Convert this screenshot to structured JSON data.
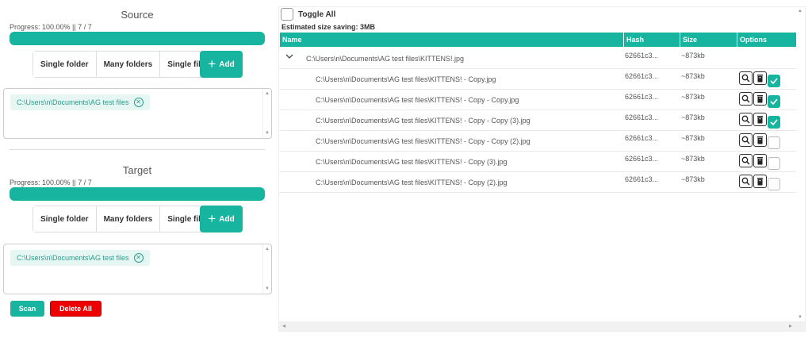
{
  "source": {
    "title": "Source",
    "progress_label": "Progress: 100.00% || 7 / 7",
    "progress": 1.0,
    "modes": [
      "Single folder",
      "Many folders",
      "Single file"
    ],
    "active_mode": 0,
    "add_label": "Add",
    "folders": [
      "C:\\Users\\n\\Documents\\AG test files"
    ]
  },
  "target": {
    "title": "Target",
    "progress_label": "Progress: 100.00% || 7 / 7",
    "progress": 1.0,
    "modes": [
      "Single folder",
      "Many folders",
      "Single file"
    ],
    "active_mode": 0,
    "add_label": "Add",
    "folders": [
      "C:\\Users\\n\\Documents\\AG test files"
    ]
  },
  "actions": {
    "scan_label": "Scan",
    "delete_all_label": "Delete All"
  },
  "results": {
    "toggle_all_label": "Toggle All",
    "estimate_label": "Estimated size saving: 3MB",
    "columns": [
      "Name",
      "Hash",
      "Size",
      "Options"
    ],
    "group": {
      "name": "C:\\Users\\n\\Documents\\AG test files\\KITTENS!.jpg",
      "hash": "62661c3...",
      "size": "~873kb"
    },
    "rows": [
      {
        "name": "C:\\Users\\n\\Documents\\AG test files\\KITTENS! - Copy.jpg",
        "hash": "62661c3...",
        "size": "~873kb",
        "checked": true
      },
      {
        "name": "C:\\Users\\n\\Documents\\AG test files\\KITTENS! - Copy - Copy.jpg",
        "hash": "62661c3...",
        "size": "~873kb",
        "checked": true
      },
      {
        "name": "C:\\Users\\n\\Documents\\AG test files\\KITTENS! - Copy - Copy (3).jpg",
        "hash": "62661c3...",
        "size": "~873kb",
        "checked": true
      },
      {
        "name": "C:\\Users\\n\\Documents\\AG test files\\KITTENS! - Copy - Copy (2).jpg",
        "hash": "62661c3...",
        "size": "~873kb",
        "checked": false
      },
      {
        "name": "C:\\Users\\n\\Documents\\AG test files\\KITTENS! - Copy (3).jpg",
        "hash": "62661c3...",
        "size": "~873kb",
        "checked": false
      },
      {
        "name": "C:\\Users\\n\\Documents\\AG test files\\KITTENS! - Copy (2).jpg",
        "hash": "62661c3...",
        "size": "~873kb",
        "checked": false
      }
    ]
  },
  "colors": {
    "accent": "#17b59f",
    "danger": "#ee0000"
  },
  "icons": {
    "add": "plus-icon",
    "remove": "close-circle-icon",
    "expand": "chevron-down-icon",
    "inspect": "magnifier-icon",
    "delete": "trash-icon",
    "check": "check-icon"
  }
}
